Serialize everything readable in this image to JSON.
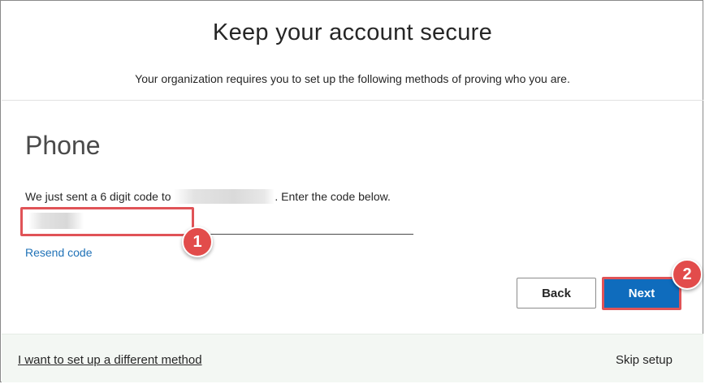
{
  "header": {
    "title": "Keep your account secure",
    "subtitle": "Your organization requires you to set up the following methods of proving who you are."
  },
  "phone_step": {
    "section_title": "Phone",
    "message_prefix": "We just sent a 6 digit code to",
    "message_suffix": ". Enter the code below.",
    "code_input": {
      "value": "",
      "placeholder": ""
    },
    "resend_label": "Resend code"
  },
  "buttons": {
    "back_label": "Back",
    "next_label": "Next"
  },
  "annotations": {
    "badge_1": "1",
    "badge_2": "2",
    "highlight_color": "#e05357"
  },
  "footer": {
    "alt_method_label": "I want to set up a different method",
    "skip_label": "Skip setup"
  },
  "colors": {
    "accent": "#0f6cbd",
    "link": "#2072b7",
    "footer_bg": "#f3f7f3"
  }
}
